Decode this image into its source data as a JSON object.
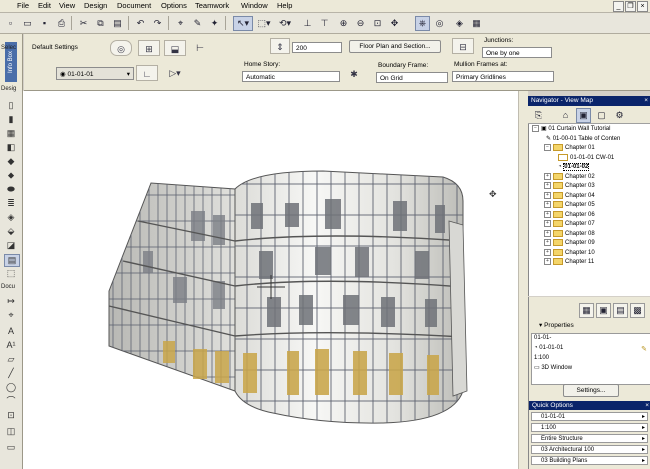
{
  "menu": [
    "File",
    "Edit",
    "View",
    "Design",
    "Document",
    "Options",
    "Teamwork",
    "Window",
    "Help"
  ],
  "infobox": {
    "default_settings": "Default Settings",
    "story_value": "200",
    "floorplan_button": "Floor Plan and Section...",
    "junctions_label": "Junctions:",
    "junctions_value": "One by one",
    "layer_value": "01-01-01",
    "home_story_label": "Home Story:",
    "home_story_value": "Automatic",
    "boundary_label": "Boundary Frame:",
    "boundary_value": "On Grid",
    "mullion_label": "Mullion Frames at:",
    "mullion_value": "Primary Gridlines",
    "tab_label": "Info Box"
  },
  "toolbox": {
    "select_heading": "Selec",
    "design_heading": "Desig",
    "document_heading": "Docu"
  },
  "navigator": {
    "title": "Navigator - View Map",
    "tree": [
      {
        "label": "01 Curtain Wall Tutorial",
        "level": 0,
        "type": "root"
      },
      {
        "label": "01-00-01 Table of Conten",
        "level": 1,
        "type": "doc"
      },
      {
        "label": "Chapter 01",
        "level": 1,
        "type": "folder-open"
      },
      {
        "label": "01-01-01 CW-01",
        "level": 2,
        "type": "view"
      },
      {
        "label": "01-01-02",
        "level": 2,
        "type": "view-selected"
      },
      {
        "label": "Chapter 02",
        "level": 1,
        "type": "folder"
      },
      {
        "label": "Chapter 03",
        "level": 1,
        "type": "folder"
      },
      {
        "label": "Chapter 04",
        "level": 1,
        "type": "folder"
      },
      {
        "label": "Chapter 05",
        "level": 1,
        "type": "folder"
      },
      {
        "label": "Chapter 06",
        "level": 1,
        "type": "folder"
      },
      {
        "label": "Chapter 07",
        "level": 1,
        "type": "folder"
      },
      {
        "label": "Chapter 08",
        "level": 1,
        "type": "folder"
      },
      {
        "label": "Chapter 09",
        "level": 1,
        "type": "folder"
      },
      {
        "label": "Chapter 10",
        "level": 1,
        "type": "folder"
      },
      {
        "label": "Chapter 11",
        "level": 1,
        "type": "folder"
      }
    ]
  },
  "properties": {
    "heading": "Properties",
    "name_value": "01-01-",
    "id_value": "01-01-01",
    "scale_value": "1:100",
    "window_value": "3D Window",
    "settings_button": "Settings..."
  },
  "quick_options": {
    "title": "Quick Options",
    "rows": [
      "01-01-01",
      "1:100",
      "Entire Structure",
      "03 Architectural 100",
      "03 Building Plans"
    ]
  },
  "colors": {
    "accent_title": "#0a246a",
    "panel_bg": "#ece9d8",
    "glass": "#f2f2f0",
    "mullion": "#6a6e78",
    "warm_glass": "#c9a64a"
  }
}
